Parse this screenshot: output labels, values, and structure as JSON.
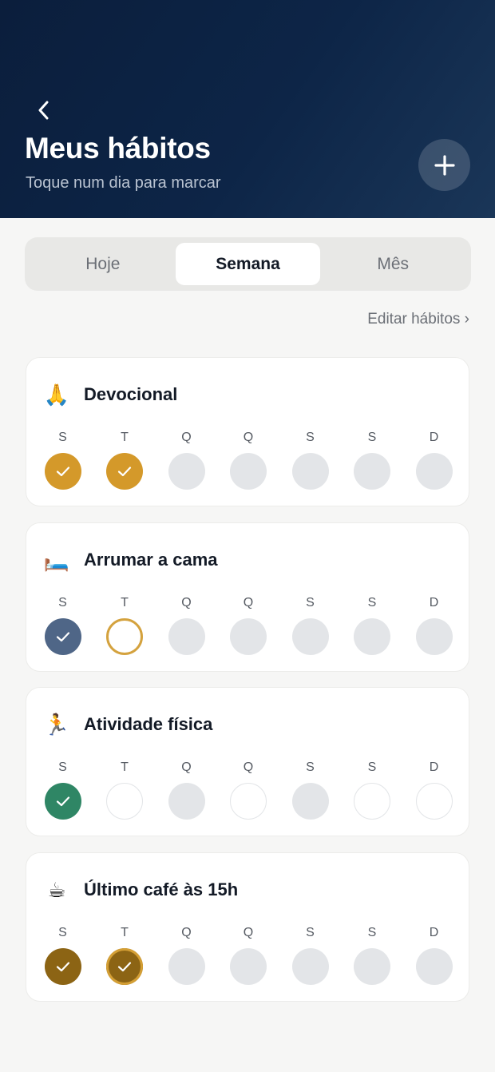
{
  "header": {
    "title": "Meus hábitos",
    "subtitle": "Toque num dia para marcar"
  },
  "tabs": [
    {
      "label": "Hoje",
      "active": false
    },
    {
      "label": "Semana",
      "active": true
    },
    {
      "label": "Mês",
      "active": false
    }
  ],
  "edit_link": "Editar hábitos ›",
  "day_labels": [
    "S",
    "T",
    "Q",
    "Q",
    "S",
    "S",
    "D"
  ],
  "habits": [
    {
      "emoji": "🙏",
      "name": "Devocional",
      "days": [
        "done-gold",
        "done-gold",
        "empty",
        "empty",
        "empty",
        "empty",
        "empty"
      ]
    },
    {
      "emoji": "🛏️",
      "name": "Arrumar a cama",
      "days": [
        "done-slate",
        "ring-gold",
        "empty",
        "empty",
        "empty",
        "empty",
        "empty"
      ]
    },
    {
      "emoji": "🏃",
      "name": "Atividade física",
      "days": [
        "done-green",
        "outline",
        "empty",
        "outline",
        "empty",
        "outline",
        "outline"
      ]
    },
    {
      "emoji": "☕",
      "name": "Último café às 15h",
      "days": [
        "done-brown",
        "done-brown-ring",
        "empty",
        "empty",
        "empty",
        "empty",
        "empty"
      ]
    }
  ],
  "colors": {
    "header_bg": "#0b1e3c",
    "gold": "#d4992a",
    "slate": "#4f6687",
    "green": "#2f8665",
    "brown": "#8c6414",
    "empty": "#e3e5e8"
  }
}
